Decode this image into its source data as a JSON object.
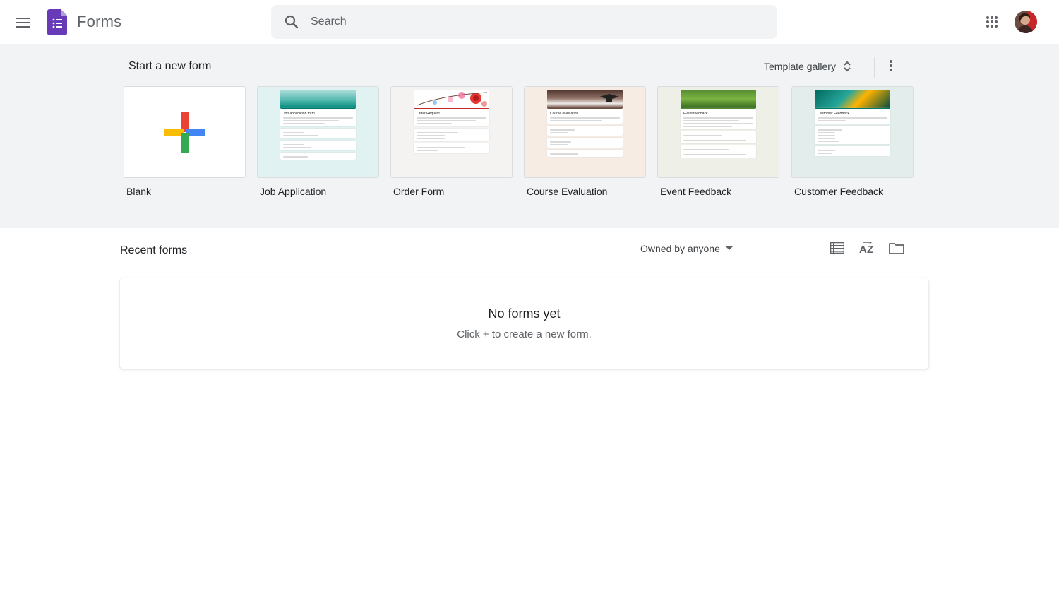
{
  "header": {
    "app_title": "Forms",
    "search_placeholder": "Search",
    "brand_color": "#673ab7"
  },
  "templates_section": {
    "title": "Start a new form",
    "gallery_label": "Template gallery",
    "items": [
      {
        "label": "Blank",
        "thumb": "blank-plus"
      },
      {
        "label": "Job Application",
        "thumb_title": "Job application form",
        "banner_color": "#4db6ac"
      },
      {
        "label": "Order Form",
        "thumb_title": "Order Request",
        "banner_color": "#f8bbd0"
      },
      {
        "label": "Course Evaluation",
        "thumb_title": "Course evaluation",
        "banner_color": "#8d6e63"
      },
      {
        "label": "Event Feedback",
        "thumb_title": "Event feedback",
        "banner_color": "#7cb342"
      },
      {
        "label": "Customer Feedback",
        "thumb_title": "Customer Feedback",
        "banner_color": "#26a69a"
      }
    ]
  },
  "recent": {
    "title": "Recent forms",
    "owner_filter": "Owned by anyone",
    "empty_title": "No forms yet",
    "empty_subtitle": "Click + to create a new form."
  }
}
